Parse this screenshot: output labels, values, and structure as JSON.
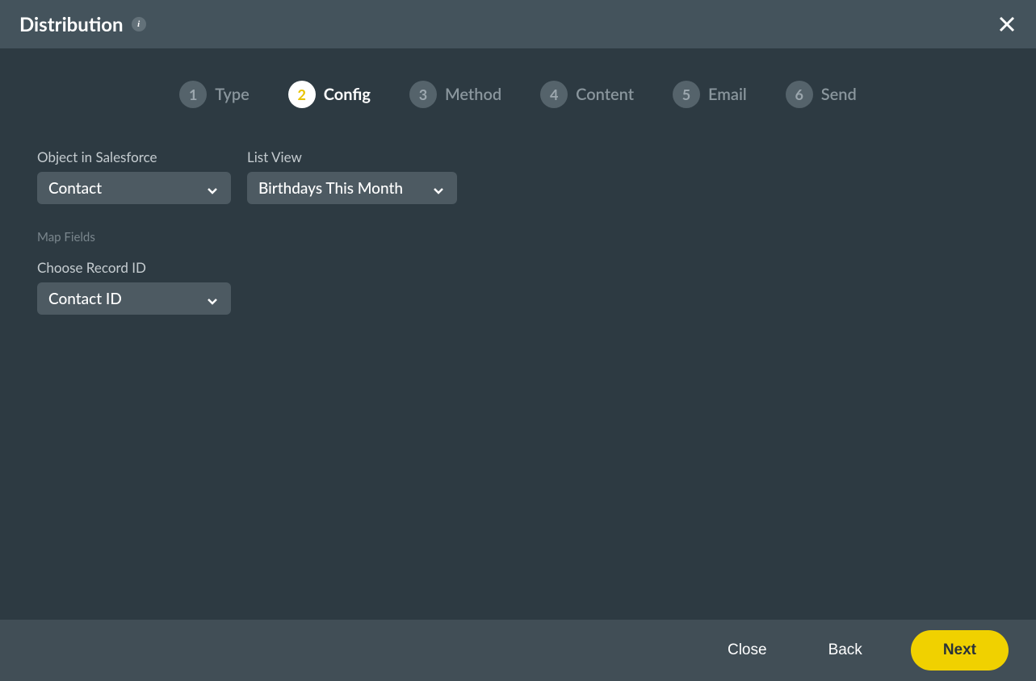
{
  "header": {
    "title": "Distribution",
    "info_label": "i"
  },
  "stepper": {
    "steps": [
      {
        "number": "1",
        "label": "Type"
      },
      {
        "number": "2",
        "label": "Config"
      },
      {
        "number": "3",
        "label": "Method"
      },
      {
        "number": "4",
        "label": "Content"
      },
      {
        "number": "5",
        "label": "Email"
      },
      {
        "number": "6",
        "label": "Send"
      }
    ],
    "active_index": 1
  },
  "form": {
    "object_label": "Object in Salesforce",
    "object_value": "Contact",
    "list_view_label": "List View",
    "list_view_value": "Birthdays This Month",
    "map_fields_label": "Map Fields",
    "record_id_label": "Choose Record ID",
    "record_id_value": "Contact ID"
  },
  "footer": {
    "close_label": "Close",
    "back_label": "Back",
    "next_label": "Next"
  }
}
